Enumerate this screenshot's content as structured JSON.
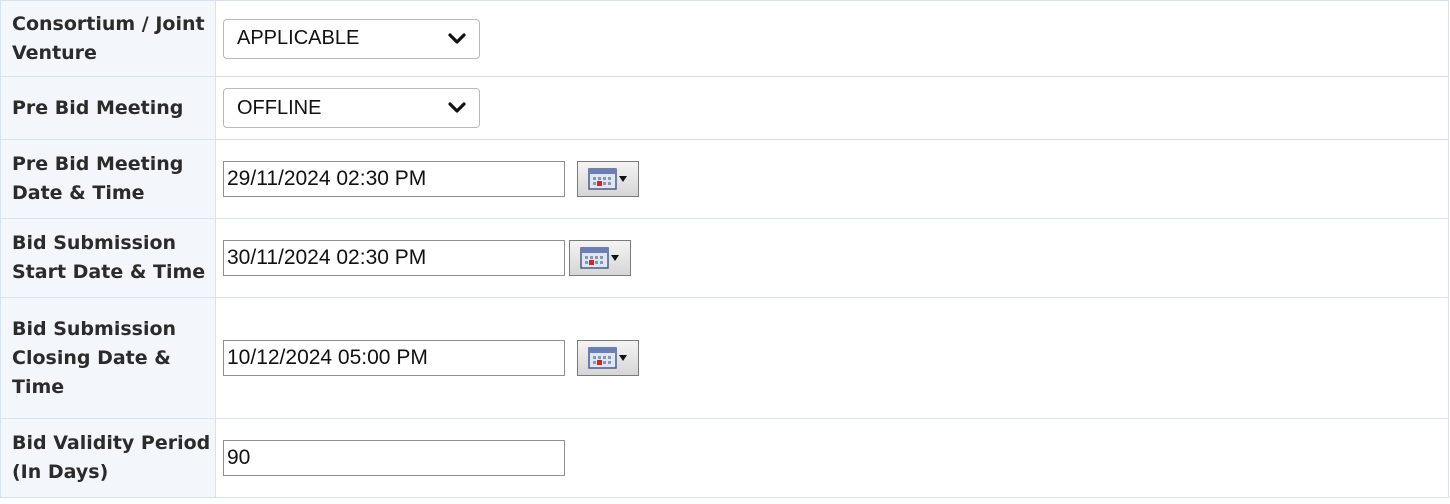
{
  "rows": [
    {
      "label": "Consortium / Joint Venture",
      "control": "select",
      "value": "APPLICABLE"
    },
    {
      "label": "Pre Bid Meeting",
      "control": "select",
      "value": "OFFLINE"
    },
    {
      "label": "Pre Bid Meeting Date & Time",
      "control": "datetime",
      "value": "29/11/2024 02:30 PM"
    },
    {
      "label": "Bid Submission Start Date & Time",
      "control": "datetime",
      "value": "30/11/2024 02:30 PM"
    },
    {
      "label": "Bid Submission Closing Date & Time",
      "control": "datetime",
      "value": "10/12/2024 05:00 PM"
    },
    {
      "label": "Bid Validity Period (In Days)",
      "control": "text",
      "value": "90"
    }
  ],
  "icons": {
    "select_arrow": "chevron-down-icon",
    "calendar": "calendar-icon"
  },
  "colors": {
    "label_bg": "#f3f7fb",
    "border": "#d6e2ee"
  }
}
